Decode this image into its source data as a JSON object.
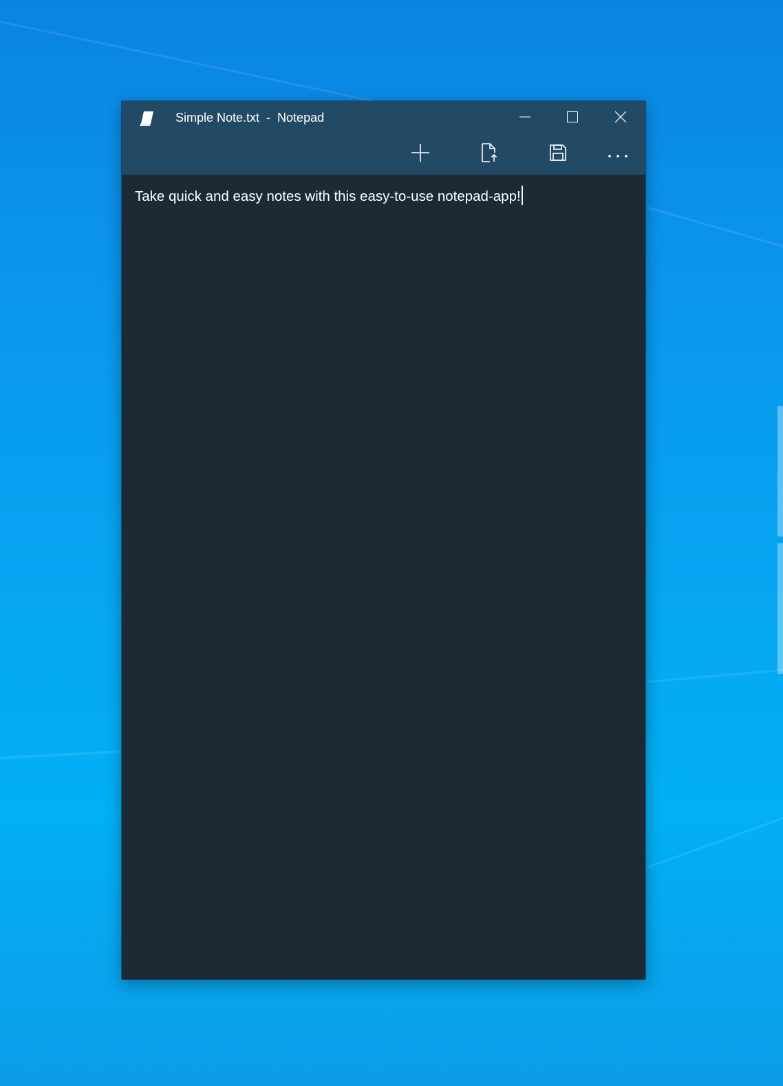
{
  "window": {
    "title": "Simple Note.txt  -  Notepad"
  },
  "titlebar_buttons": {
    "minimize": "minimize",
    "maximize": "maximize",
    "close": "close"
  },
  "toolbar": {
    "items": [
      {
        "icon": "plus-icon"
      },
      {
        "icon": "open-file-icon"
      },
      {
        "icon": "save-icon"
      },
      {
        "icon": "more-icon"
      }
    ]
  },
  "editor": {
    "content": "Take quick and easy notes with this easy-to-use notepad-app!"
  },
  "colors": {
    "titlebar": "#234a64",
    "editor_background": "#1b2a35",
    "text": "#ffffff",
    "desktop": "#0b95ec"
  }
}
